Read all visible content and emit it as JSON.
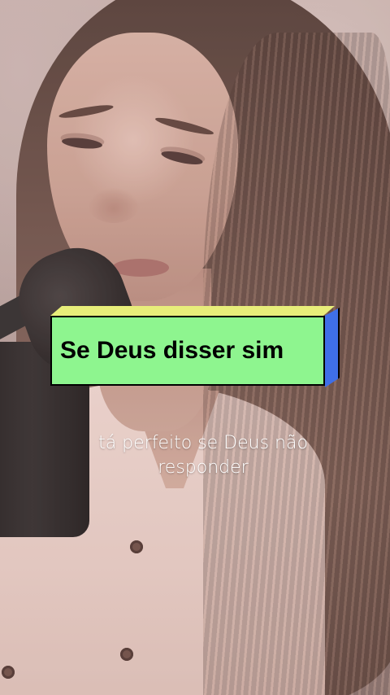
{
  "caption": {
    "title": "Se Deus disser sim",
    "colors": {
      "face": "#8ef58f",
      "top": "#e8ee7a",
      "side": "#3f6fe8"
    }
  },
  "lyric": {
    "line1": "tá perfeito se Deus não",
    "line2": "responder"
  }
}
